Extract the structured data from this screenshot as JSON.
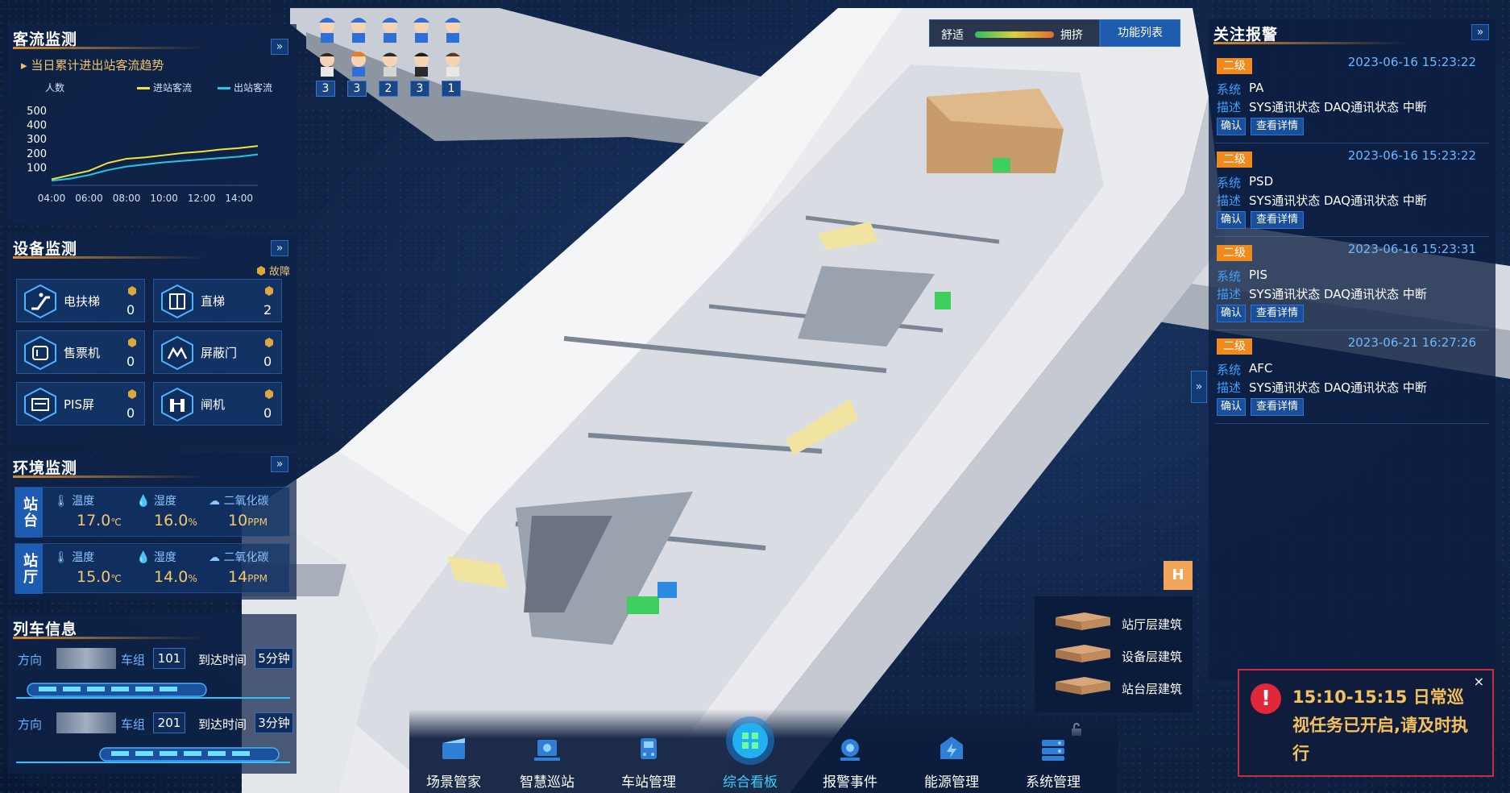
{
  "colors": {
    "accent_orange": "#d58a2f",
    "entry_line": "#f0e43a",
    "exit_line": "#22c7e8",
    "alarm_level": "#f08a1c",
    "toast_border": "#c92c3a",
    "toast_text": "#f5c15a"
  },
  "passenger_flow": {
    "title": "客流监测",
    "subtitle": "当日累计进出站客流趋势",
    "unit_label": "人数",
    "legend_in": "进站客流",
    "legend_out": "出站客流"
  },
  "chart_data": {
    "type": "line",
    "title": "",
    "xlabel": "",
    "ylabel": "人数",
    "x": [
      "04:00",
      "06:00",
      "08:00",
      "10:00",
      "12:00",
      "14:00"
    ],
    "y_ticks": [
      "500",
      "400",
      "300",
      "200",
      "100"
    ],
    "ylim": [
      0,
      500
    ],
    "series": [
      {
        "name": "进站客流",
        "color": "#f0e43a",
        "x": [
          4,
          5,
          6,
          7,
          8,
          9,
          10,
          11,
          12,
          13,
          14,
          15
        ],
        "values": [
          20,
          50,
          80,
          135,
          165,
          175,
          190,
          205,
          215,
          230,
          240,
          255
        ]
      },
      {
        "name": "出站客流",
        "color": "#22c7e8",
        "x": [
          4,
          5,
          6,
          7,
          8,
          9,
          10,
          11,
          12,
          13,
          14,
          15
        ],
        "values": [
          10,
          25,
          50,
          85,
          110,
          125,
          140,
          150,
          160,
          170,
          180,
          195
        ]
      }
    ]
  },
  "equipment": {
    "title": "设备监测",
    "fault_label": "故障",
    "items": [
      {
        "label": "电扶梯",
        "count": "0",
        "icon": "escalator-icon"
      },
      {
        "label": "直梯",
        "count": "2",
        "icon": "elevator-icon"
      },
      {
        "label": "售票机",
        "count": "0",
        "icon": "ticket-machine-icon"
      },
      {
        "label": "屏蔽门",
        "count": "0",
        "icon": "screen-door-icon"
      },
      {
        "label": "PIS屏",
        "count": "0",
        "icon": "pis-screen-icon"
      },
      {
        "label": "闸机",
        "count": "0",
        "icon": "gate-icon"
      }
    ]
  },
  "environment": {
    "title": "环境监测",
    "rows": [
      {
        "tag": "站台",
        "temp_label": "温度",
        "temp": "17.0",
        "temp_unit": "℃",
        "hum_label": "湿度",
        "hum": "16.0",
        "hum_unit": "%",
        "co2_label": "二氧化碳",
        "co2": "10",
        "co2_unit": "PPM"
      },
      {
        "tag": "站厅",
        "temp_label": "温度",
        "temp": "15.0",
        "temp_unit": "℃",
        "hum_label": "湿度",
        "hum": "14.0",
        "hum_unit": "%",
        "co2_label": "二氧化碳",
        "co2": "14",
        "co2_unit": "PPM"
      }
    ]
  },
  "trains": {
    "title": "列车信息",
    "rows": [
      {
        "dir_label": "方向",
        "group_label": "车组",
        "group": "101",
        "arrive_label": "到达时间",
        "arrive": "5分钟"
      },
      {
        "dir_label": "方向",
        "group_label": "车组",
        "group": "201",
        "arrive_label": "到达时间",
        "arrive": "3分钟"
      }
    ]
  },
  "staff": {
    "counts": [
      "3",
      "3",
      "2",
      "3",
      "1"
    ]
  },
  "comfort": {
    "comfort_label": "舒适",
    "crowded_label": "拥挤",
    "function_list": "功能列表"
  },
  "alarms": {
    "title": "关注报警",
    "sys_key": "系统",
    "desc_key": "描述",
    "confirm": "确认",
    "detail": "查看详情",
    "items": [
      {
        "level": "二级",
        "time": "2023-06-16 15:23:22",
        "system": "PA",
        "desc": "SYS通讯状态 DAQ通讯状态 中断"
      },
      {
        "level": "二级",
        "time": "2023-06-16 15:23:22",
        "system": "PSD",
        "desc": "SYS通讯状态 DAQ通讯状态 中断"
      },
      {
        "level": "二级",
        "time": "2023-06-16 15:23:31",
        "system": "PIS",
        "desc": "SYS通讯状态 DAQ通讯状态 中断"
      },
      {
        "level": "二级",
        "time": "2023-06-21 16:27:26",
        "system": "AFC",
        "desc": "SYS通讯状态 DAQ通讯状态 中断"
      }
    ]
  },
  "layers": {
    "h_label": "H",
    "items": [
      "站厅层建筑",
      "设备层建筑",
      "站台层建筑"
    ]
  },
  "nav": {
    "items": [
      {
        "label": "场景管家",
        "icon": "scene-icon"
      },
      {
        "label": "智慧巡站",
        "icon": "patrol-icon"
      },
      {
        "label": "车站管理",
        "icon": "station-icon"
      },
      {
        "label": "综合看板",
        "icon": "dashboard-icon"
      },
      {
        "label": "报警事件",
        "icon": "alarm-icon"
      },
      {
        "label": "能源管理",
        "icon": "energy-icon"
      },
      {
        "label": "系统管理",
        "icon": "system-icon"
      }
    ],
    "active_index": 3
  },
  "toast": {
    "message": "15:10-15:15 日常巡视任务已开启,请及时执行",
    "close": "×"
  }
}
